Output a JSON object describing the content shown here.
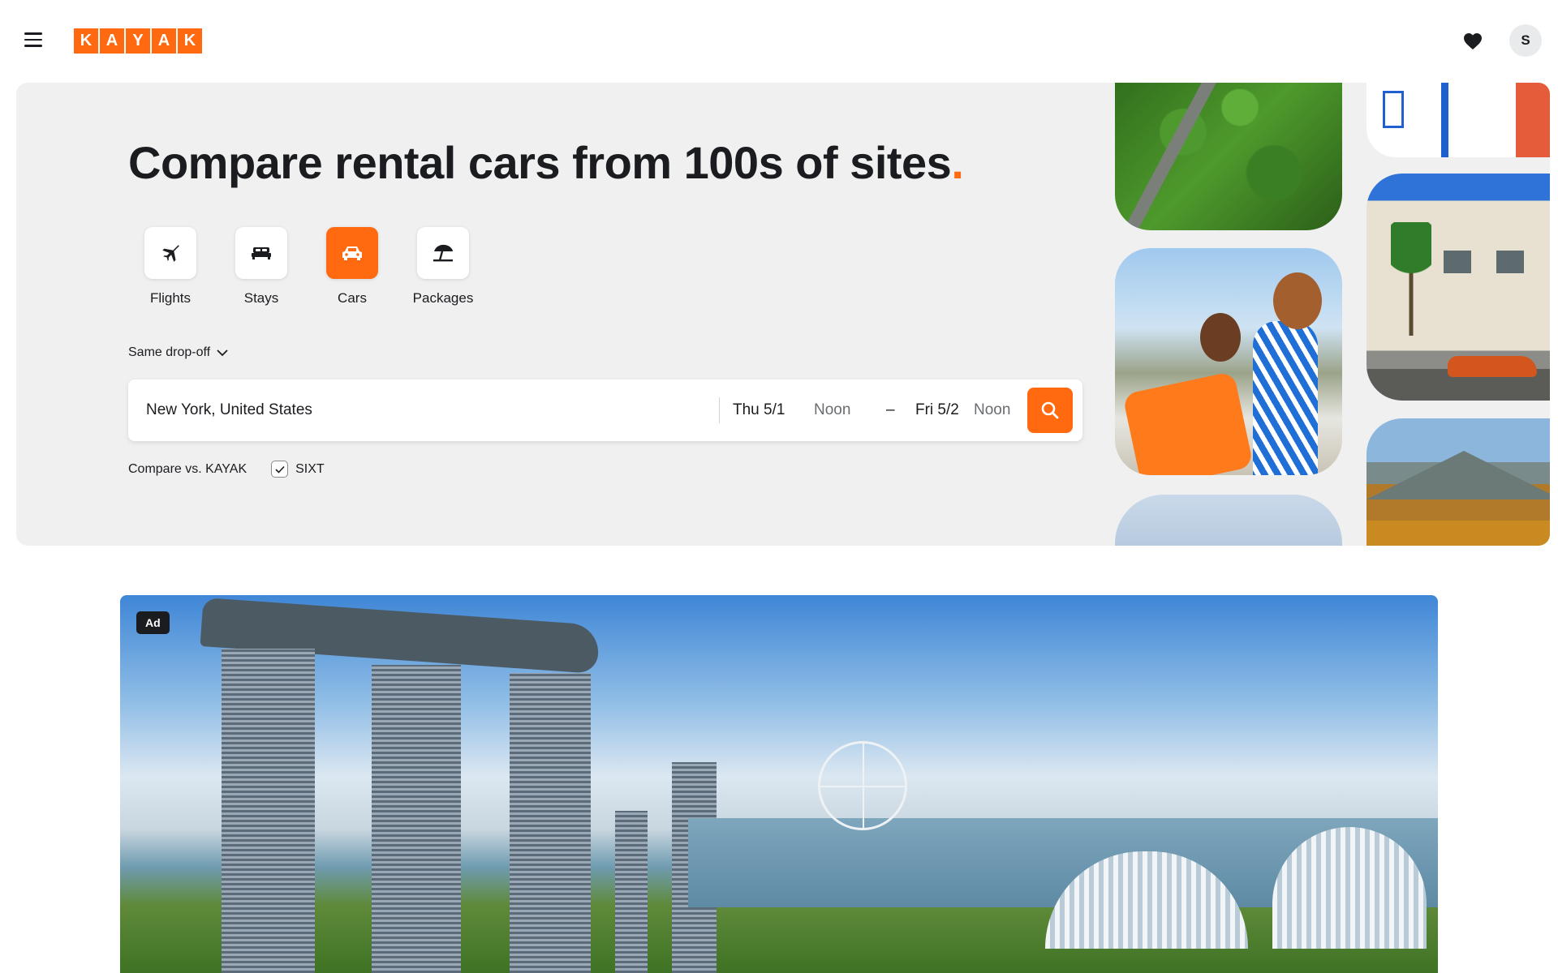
{
  "header": {
    "logo_letters": [
      "K",
      "A",
      "Y",
      "A",
      "K"
    ],
    "avatar_initial": "S"
  },
  "hero": {
    "headline": "Compare rental cars from 100s of sites",
    "headline_dot": ".",
    "verticals": [
      {
        "label": "Flights",
        "icon": "plane-icon",
        "active": false
      },
      {
        "label": "Stays",
        "icon": "bed-icon",
        "active": false
      },
      {
        "label": "Cars",
        "icon": "car-icon",
        "active": true
      },
      {
        "label": "Packages",
        "icon": "beach-umbrella-icon",
        "active": false
      }
    ],
    "dropoff_label": "Same drop-off",
    "search": {
      "location_value": "New York, United States",
      "pickup_date": "Thu 5/1",
      "pickup_time": "Noon",
      "date_separator": "–",
      "dropoff_date": "Fri 5/2",
      "dropoff_time": "Noon"
    },
    "compare": {
      "label": "Compare vs. KAYAK",
      "options": [
        {
          "label": "SIXT",
          "checked": true
        }
      ]
    }
  },
  "ad": {
    "badge": "Ad"
  },
  "colors": {
    "brand_orange": "#ff690f",
    "hero_background": "#f0f0f1",
    "text_primary": "#1a1c1f",
    "text_muted": "#696c70"
  }
}
